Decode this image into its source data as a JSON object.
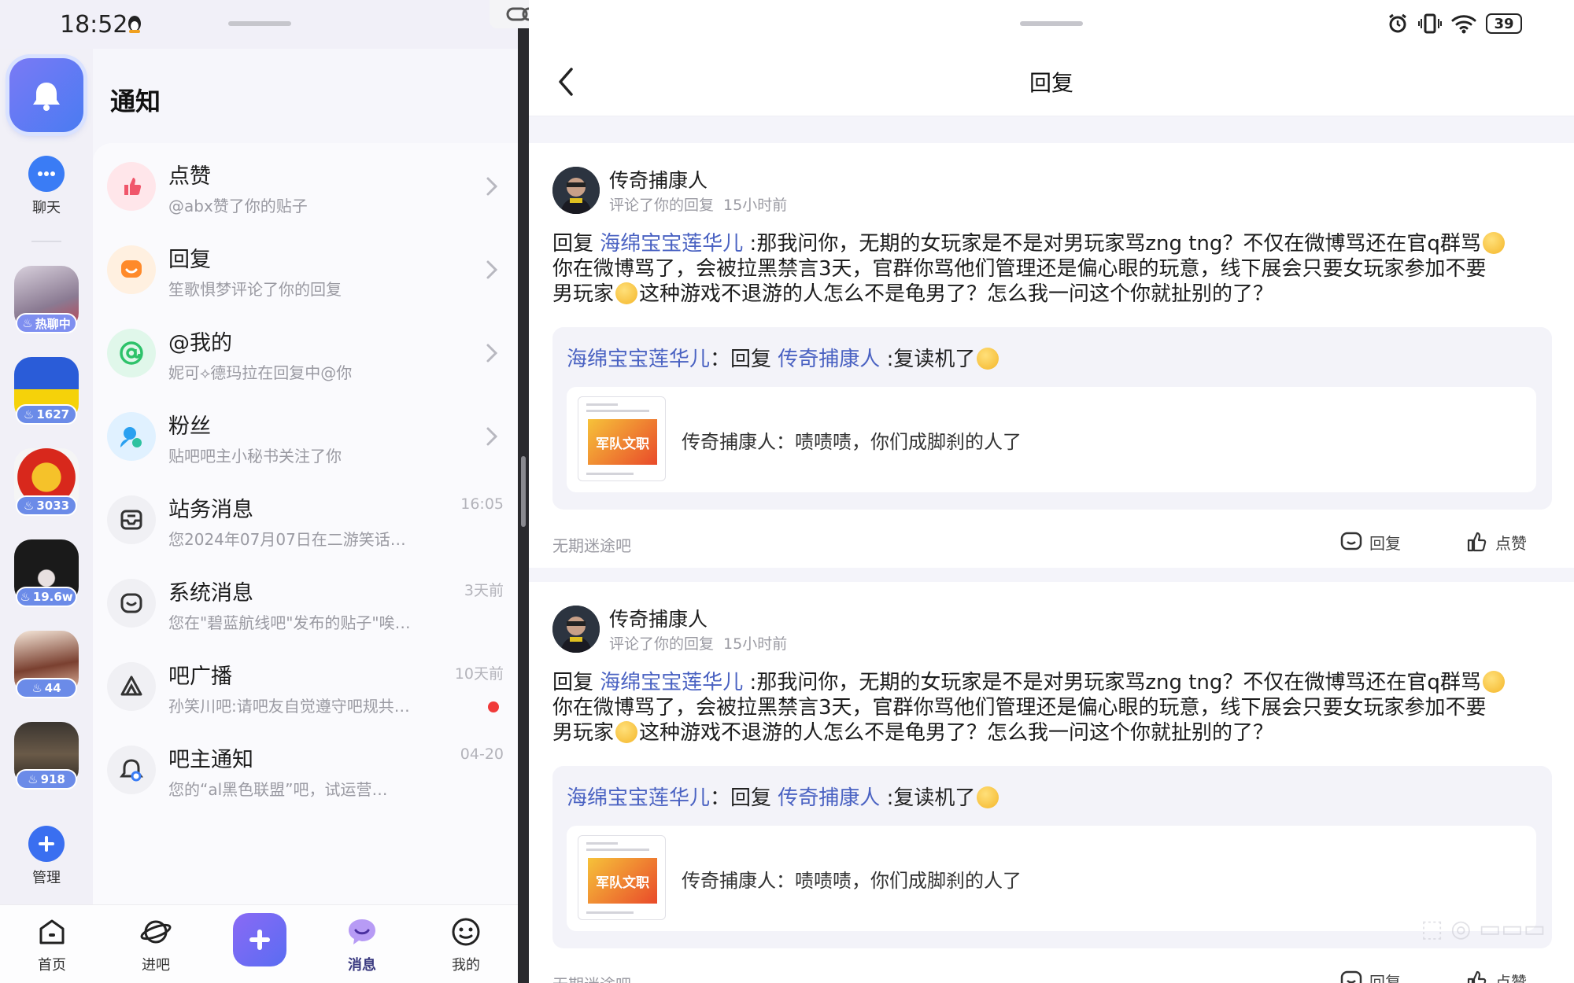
{
  "left_status": {
    "time": "18:52"
  },
  "rail": {
    "chat_label": "聊天",
    "forums": [
      {
        "badge": "热聊中",
        "hot": true
      },
      {
        "badge": "1627"
      },
      {
        "badge": "3033"
      },
      {
        "badge": "19.6w"
      },
      {
        "badge": "44"
      },
      {
        "badge": "918"
      }
    ],
    "manage_label": "管理"
  },
  "notifications": {
    "title": "通知",
    "items": [
      {
        "title": "点赞",
        "sub": "@abx赞了你的贴子",
        "time": "",
        "icon_color": "#f0566a",
        "icon_bg": "#ffe6ea",
        "icon": "thumb-up-icon",
        "chevron": true
      },
      {
        "title": "回复",
        "sub": "笙歌惧梦评论了你的回复",
        "time": "",
        "icon_color": "#ff8a2a",
        "icon_bg": "#fff0e0",
        "icon": "reply-icon",
        "chevron": true
      },
      {
        "title": "@我的",
        "sub": "妮可⟡德玛拉在回复中@你",
        "time": "",
        "icon_color": "#2ec26a",
        "icon_bg": "#e0f7ea",
        "icon": "at-icon",
        "chevron": true
      },
      {
        "title": "粉丝",
        "sub": "贴吧吧主小秘书关注了你",
        "time": "",
        "icon_color": "#2aa0f0",
        "icon_bg": "#e0f1ff",
        "icon": "fans-icon",
        "chevron": true
      },
      {
        "title": "站务消息",
        "sub": "您2024年07月07日在二游笑话…",
        "time": "16:05",
        "icon_color": "#333",
        "icon_bg": "#f0f0f4",
        "icon": "inbox-icon",
        "chevron": false
      },
      {
        "title": "系统消息",
        "sub": "您在\"碧蓝航线吧\"发布的贴子\"唉…",
        "time": "3天前",
        "icon_color": "#333",
        "icon_bg": "#f0f0f4",
        "icon": "system-icon",
        "chevron": false
      },
      {
        "title": "吧广播",
        "sub": "孙笑川吧:请吧友自觉遵守吧规共…",
        "time": "10天前",
        "icon_color": "#333",
        "icon_bg": "#f0f0f4",
        "icon": "broadcast-icon",
        "chevron": false,
        "dot": true
      },
      {
        "title": "吧主通知",
        "sub": "您的“al黑色联盟”吧，试运营…",
        "time": "04-20",
        "icon_color": "#333",
        "icon_bg": "#f0f0f4",
        "icon": "admin-bell-icon",
        "chevron": false
      }
    ]
  },
  "bottom_nav": [
    {
      "label": "首页",
      "icon": "home-icon"
    },
    {
      "label": "进吧",
      "icon": "planet-icon"
    },
    {
      "label": "消息",
      "icon": "message-icon",
      "active": true
    },
    {
      "label": "我的",
      "icon": "profile-icon"
    }
  ],
  "right_status": {
    "battery": "39"
  },
  "reply_page": {
    "title": "回复",
    "cards": [
      {
        "author": "传奇捕康人",
        "action": "评论了你的回复",
        "time": "15小时前",
        "reply_prefix": "回复",
        "reply_to": "海绵宝宝莲华儿",
        "text1": " :那我问你，无期的女玩家是不是对男玩家骂zng tng？不仅在微博骂还在官q群骂",
        "text2": "你在微博骂了，会被拉黑禁言3天，官群你骂他们管理还是偏心眼的玩意，线下展会只要女玩家参加不要",
        "text3a": "男玩家",
        "text3b": "这种游戏不退游的人怎么不是龟男了？怎么我一问这个你就扯别的了？",
        "quote_author": "海绵宝宝莲华儿",
        "quote_mid": "：回复",
        "quote_target": "传奇捕康人",
        "quote_text": " :复读机了",
        "inner_text": "传奇捕康人：啧啧啧，你们成脚刹的人了",
        "thumb_text": "军队文职",
        "forum": "无期迷途吧",
        "reply_label": "回复",
        "like_label": "点赞"
      },
      {
        "author": "传奇捕康人",
        "action": "评论了你的回复",
        "time": "15小时前",
        "reply_prefix": "回复",
        "reply_to": "海绵宝宝莲华儿",
        "text1": " :那我问你，无期的女玩家是不是对男玩家骂zng tng？不仅在微博骂还在官q群骂",
        "text2": "你在微博骂了，会被拉黑禁言3天，官群你骂他们管理还是偏心眼的玩意，线下展会只要女玩家参加不要",
        "text3a": "男玩家",
        "text3b": "这种游戏不退游的人怎么不是龟男了？怎么我一问这个你就扯别的了？",
        "quote_author": "海绵宝宝莲华儿",
        "quote_mid": "：回复",
        "quote_target": "传奇捕康人",
        "quote_text": " :复读机了",
        "inner_text": "传奇捕康人：啧啧啧，你们成脚刹的人了",
        "thumb_text": "军队文职",
        "forum": "无期迷途吧",
        "reply_label": "回复",
        "like_label": "点赞"
      }
    ]
  }
}
